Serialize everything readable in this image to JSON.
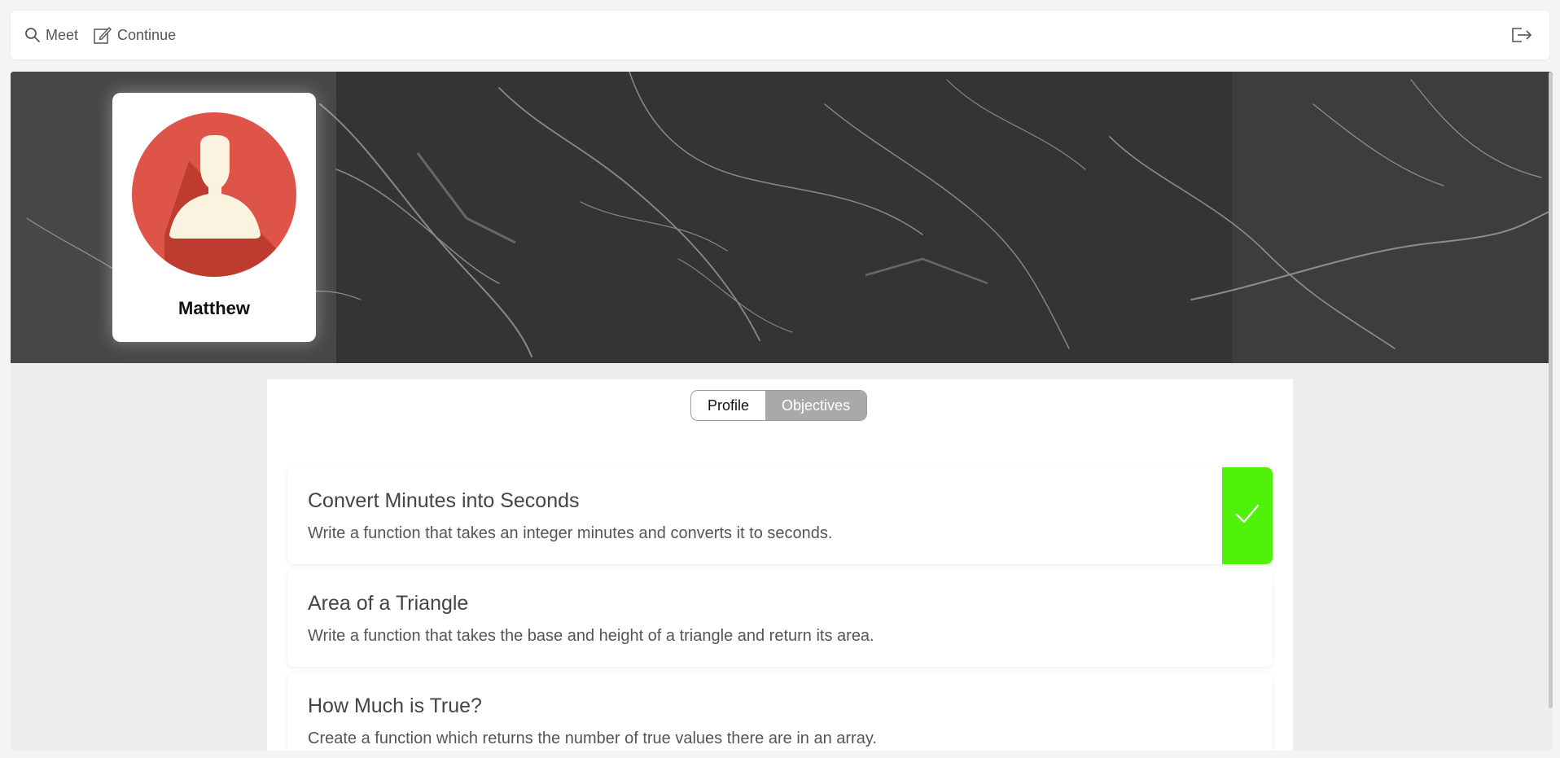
{
  "topbar": {
    "nav": [
      {
        "label": "Meet",
        "icon": "search-icon"
      },
      {
        "label": "Continue",
        "icon": "edit-icon"
      }
    ],
    "logout_icon": "logout-icon"
  },
  "profile": {
    "name": "Matthew",
    "avatar_icon": "user-avatar-icon",
    "avatar_color": "#de5448"
  },
  "tabs": [
    {
      "label": "Profile",
      "active": false
    },
    {
      "label": "Objectives",
      "active": true
    }
  ],
  "objectives": [
    {
      "title": "Convert Minutes into Seconds",
      "description": "Write a function that takes an integer minutes and converts it to seconds.",
      "completed": true
    },
    {
      "title": "Area of a Triangle",
      "description": "Write a function that takes the base and height of a triangle and return its area.",
      "completed": false
    },
    {
      "title": "How Much is True?",
      "description": "Create a function which returns the number of true values there are in an array.",
      "completed": false
    }
  ],
  "colors": {
    "completed_badge": "#50f20a",
    "active_tab": "#a9a9a9"
  }
}
